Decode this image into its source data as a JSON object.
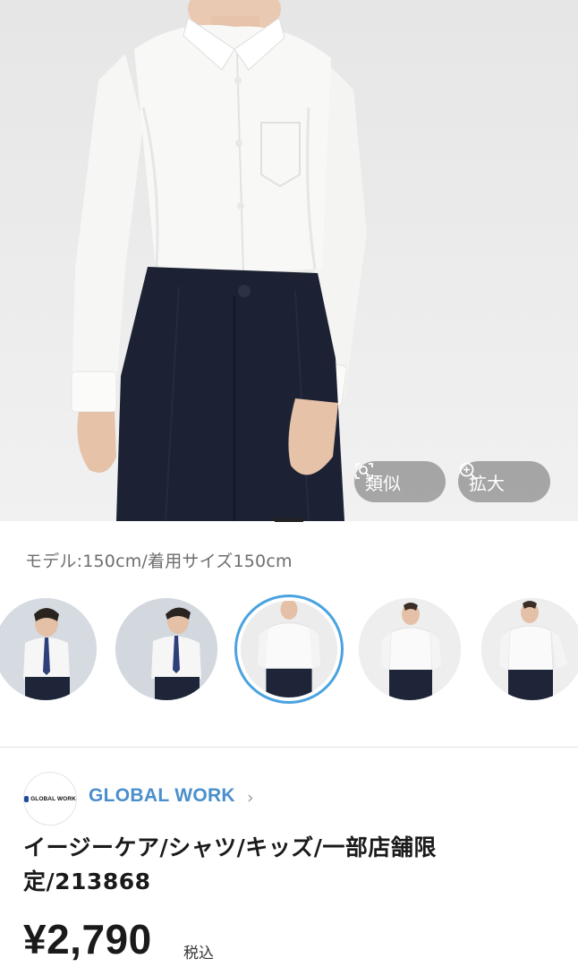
{
  "hero": {
    "similar_label": "類似",
    "zoom_label": "拡大"
  },
  "caption": "モデル:150cm/着用サイズ150cm",
  "thumbnails": [
    {
      "icon": "model-with-tie"
    },
    {
      "icon": "model-with-tie"
    },
    {
      "icon": "model-shirt-front",
      "selected": true
    },
    {
      "icon": "model-shirt-front"
    },
    {
      "icon": "model-shirt-angle"
    }
  ],
  "brand": {
    "logo_text": "GLOBAL WORK",
    "name": "GLOBAL WORK",
    "chevron": "›"
  },
  "product": {
    "title": "イージーケア/シャツ/キッズ/一部店舗限定/213868",
    "price": "¥2,790",
    "tax_label": "税込"
  },
  "colors": {
    "accent": "#4aa3df",
    "brand_link": "#4a8fcc",
    "pants_navy": "#1c2233"
  }
}
